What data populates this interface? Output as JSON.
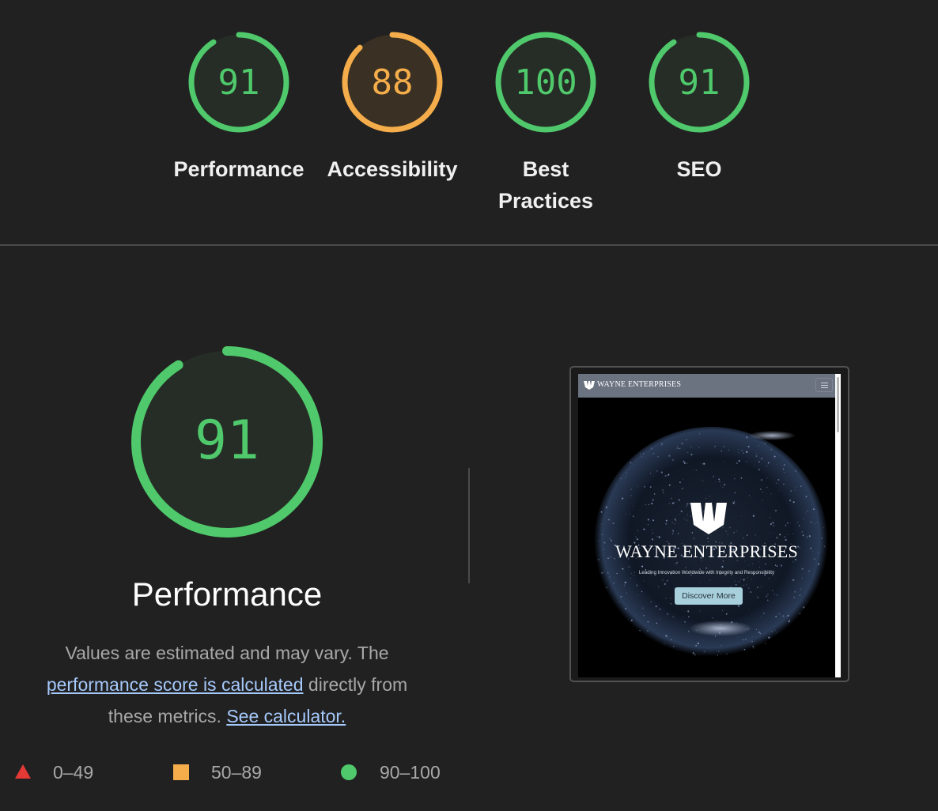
{
  "colors": {
    "background": "#212121",
    "pass": "#0cce6b",
    "pass_ring": "#4fc96b",
    "average": "#ffa400",
    "average_ring": "#f4ad4a",
    "fail": "#e53935",
    "link": "#a5c9fb"
  },
  "categories": [
    {
      "label": "Performance",
      "score": 91,
      "rating": "pass"
    },
    {
      "label": "Accessibility",
      "score": 88,
      "rating": "average"
    },
    {
      "label": "Best Practices",
      "score": 100,
      "rating": "pass"
    },
    {
      "label": "SEO",
      "score": 91,
      "rating": "pass"
    }
  ],
  "performance": {
    "score": 91,
    "title": "Performance",
    "desc_prefix": "Values are estimated and may vary. The ",
    "desc_link": "performance score is calculated",
    "desc_middle": " directly from these metrics. ",
    "calc_link": "See calculator."
  },
  "screenshot": {
    "nav_brand": "WAYNE ENTERPRISES",
    "menu_icon": "hamburger-menu-icon",
    "hero_title": "WAYNE ENTERPRISES",
    "hero_subtitle": "Leading Innovation Worldwide with Integrity and Responsibility",
    "cta_label": "Discover More"
  },
  "legend": [
    {
      "range": "0–49",
      "shape": "triangle",
      "icon": "fail-triangle-icon"
    },
    {
      "range": "50–89",
      "shape": "square",
      "icon": "average-square-icon"
    },
    {
      "range": "90–100",
      "shape": "circle",
      "icon": "pass-circle-icon"
    }
  ]
}
